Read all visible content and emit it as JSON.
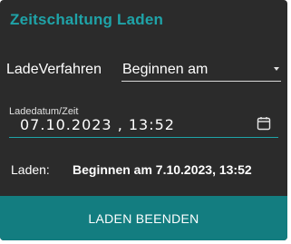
{
  "dialog": {
    "title": "Zeitschaltung Laden",
    "method": {
      "label": "LadeVerfahren",
      "selected": "Beginnen am"
    },
    "datetime": {
      "label": "Ladedatum/Zeit",
      "value": "07.10.2023 , 13:52"
    },
    "summary": {
      "label": "Laden:",
      "value": "Beginnen am 7.10.2023, 13:52"
    },
    "action_label": "LADEN BEENDEN"
  },
  "colors": {
    "background": "#2b2b2b",
    "accent": "#1fa3a8",
    "button": "#137d80",
    "text": "#ffffff"
  },
  "icons": {
    "select_caret": "caret-down-icon",
    "date_picker": "calendar-icon"
  }
}
